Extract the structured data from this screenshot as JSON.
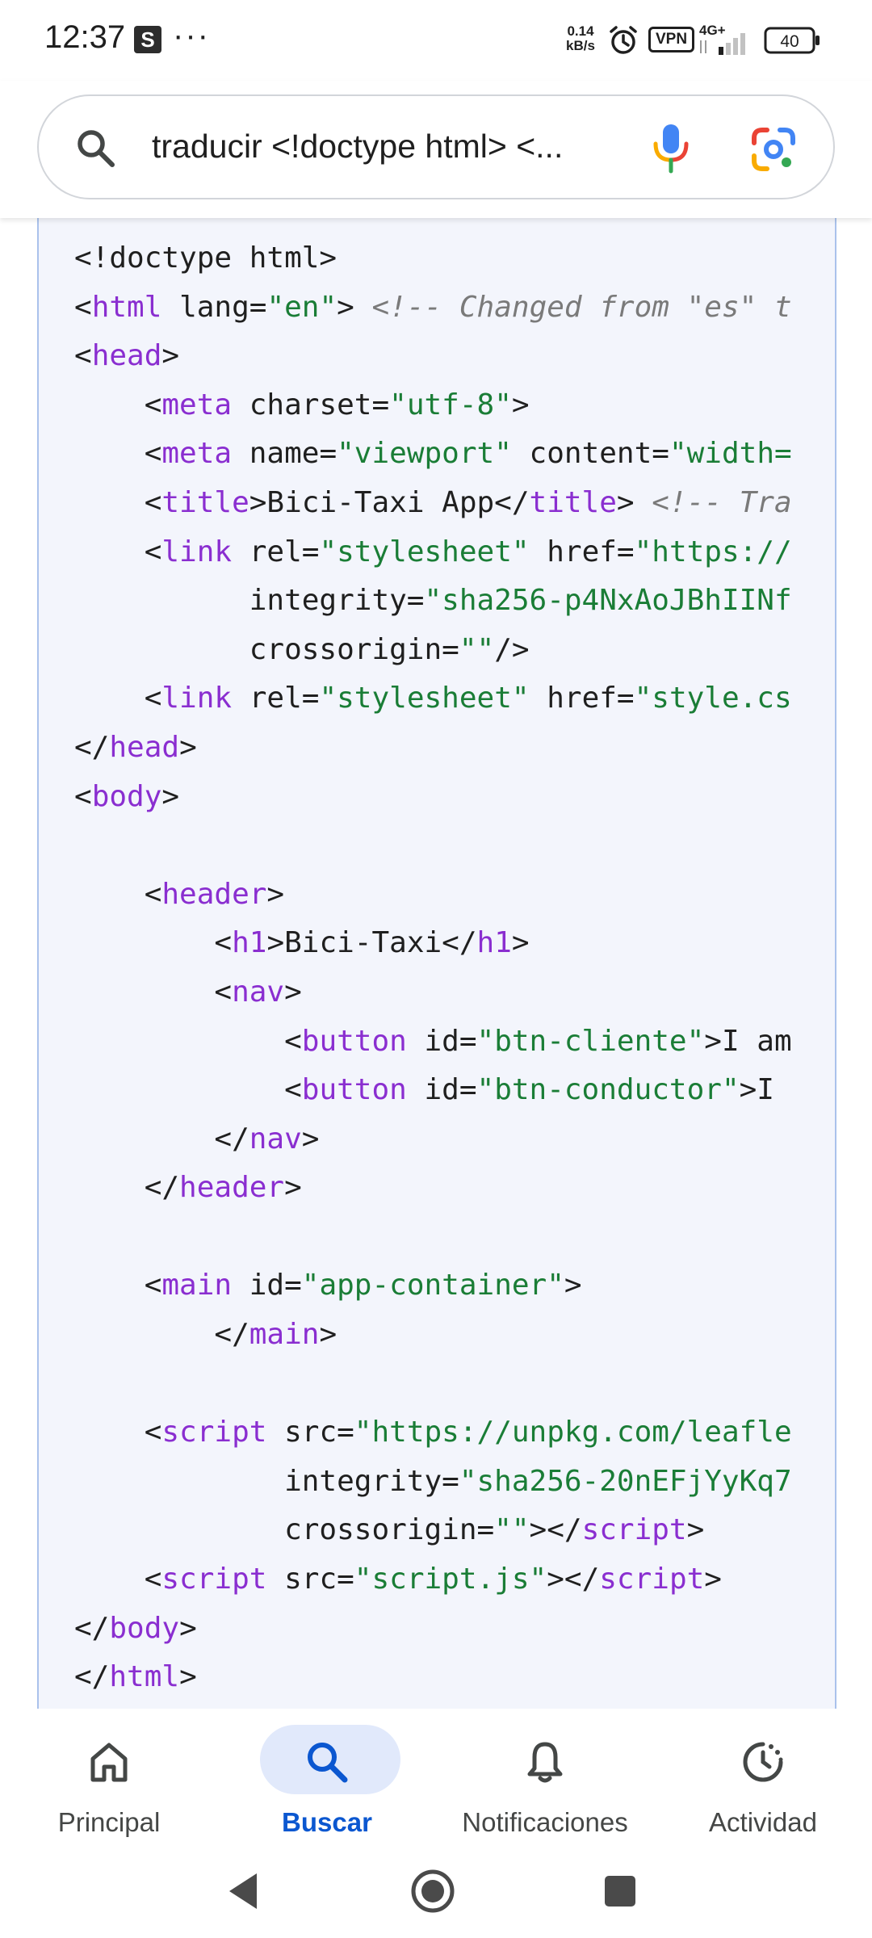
{
  "status_bar": {
    "time": "12:37",
    "app_badge": "S",
    "more": "···",
    "speed_value": "0.14",
    "speed_unit": "kB/s",
    "vpn": "VPN",
    "network": "4G+",
    "battery": "40"
  },
  "search": {
    "query": "traducir <!doctype html> <..."
  },
  "code": {
    "lines": [
      [
        [
          "pun",
          "<!doctype html>"
        ]
      ],
      [
        [
          "pun",
          "<"
        ],
        [
          "tag",
          "html"
        ],
        [
          "pun",
          " lang="
        ],
        [
          "str",
          "\"en\""
        ],
        [
          "pun",
          "> "
        ],
        [
          "com",
          "<!-- Changed from \"es\" t"
        ]
      ],
      [
        [
          "pun",
          "<"
        ],
        [
          "tag",
          "head"
        ],
        [
          "pun",
          ">"
        ]
      ],
      [
        [
          "pun",
          "    <"
        ],
        [
          "tag",
          "meta"
        ],
        [
          "pun",
          " charset="
        ],
        [
          "str",
          "\"utf-8\""
        ],
        [
          "pun",
          ">"
        ]
      ],
      [
        [
          "pun",
          "    <"
        ],
        [
          "tag",
          "meta"
        ],
        [
          "pun",
          " name="
        ],
        [
          "str",
          "\"viewport\""
        ],
        [
          "pun",
          " content="
        ],
        [
          "str",
          "\"width="
        ]
      ],
      [
        [
          "pun",
          "    <"
        ],
        [
          "tag",
          "title"
        ],
        [
          "pun",
          ">Bici-Taxi App</"
        ],
        [
          "tag",
          "title"
        ],
        [
          "pun",
          "> "
        ],
        [
          "com",
          "<!-- Tra"
        ]
      ],
      [
        [
          "pun",
          "    <"
        ],
        [
          "tag",
          "link"
        ],
        [
          "pun",
          " rel="
        ],
        [
          "str",
          "\"stylesheet\""
        ],
        [
          "pun",
          " href="
        ],
        [
          "str",
          "\"https://"
        ]
      ],
      [
        [
          "pun",
          "          integrity="
        ],
        [
          "str",
          "\"sha256-p4NxAoJBhIINf"
        ]
      ],
      [
        [
          "pun",
          "          crossorigin="
        ],
        [
          "str",
          "\"\""
        ],
        [
          "pun",
          "/>"
        ]
      ],
      [
        [
          "pun",
          "    <"
        ],
        [
          "tag",
          "link"
        ],
        [
          "pun",
          " rel="
        ],
        [
          "str",
          "\"stylesheet\""
        ],
        [
          "pun",
          " href="
        ],
        [
          "str",
          "\"style.cs"
        ]
      ],
      [
        [
          "pun",
          "</"
        ],
        [
          "tag",
          "head"
        ],
        [
          "pun",
          ">"
        ]
      ],
      [
        [
          "pun",
          "<"
        ],
        [
          "tag",
          "body"
        ],
        [
          "pun",
          ">"
        ]
      ],
      [],
      [
        [
          "pun",
          "    <"
        ],
        [
          "tag",
          "header"
        ],
        [
          "pun",
          ">"
        ]
      ],
      [
        [
          "pun",
          "        <"
        ],
        [
          "tag",
          "h1"
        ],
        [
          "pun",
          ">Bici-Taxi</"
        ],
        [
          "tag",
          "h1"
        ],
        [
          "pun",
          ">"
        ]
      ],
      [
        [
          "pun",
          "        <"
        ],
        [
          "tag",
          "nav"
        ],
        [
          "pun",
          ">"
        ]
      ],
      [
        [
          "pun",
          "            <"
        ],
        [
          "tag",
          "button"
        ],
        [
          "pun",
          " id="
        ],
        [
          "str",
          "\"btn-cliente\""
        ],
        [
          "pun",
          ">I am"
        ]
      ],
      [
        [
          "pun",
          "            <"
        ],
        [
          "tag",
          "button"
        ],
        [
          "pun",
          " id="
        ],
        [
          "str",
          "\"btn-conductor\""
        ],
        [
          "pun",
          ">I"
        ]
      ],
      [
        [
          "pun",
          "        </"
        ],
        [
          "tag",
          "nav"
        ],
        [
          "pun",
          ">"
        ]
      ],
      [
        [
          "pun",
          "    </"
        ],
        [
          "tag",
          "header"
        ],
        [
          "pun",
          ">"
        ]
      ],
      [],
      [
        [
          "pun",
          "    <"
        ],
        [
          "tag",
          "main"
        ],
        [
          "pun",
          " id="
        ],
        [
          "str",
          "\"app-container\""
        ],
        [
          "pun",
          ">"
        ]
      ],
      [
        [
          "pun",
          "        </"
        ],
        [
          "tag",
          "main"
        ],
        [
          "pun",
          ">"
        ]
      ],
      [],
      [
        [
          "pun",
          "    <"
        ],
        [
          "tag",
          "script"
        ],
        [
          "pun",
          " src="
        ],
        [
          "str",
          "\"https://unpkg.com/leafle"
        ]
      ],
      [
        [
          "pun",
          "            integrity="
        ],
        [
          "str",
          "\"sha256-20nEFjYyKq7"
        ]
      ],
      [
        [
          "pun",
          "            crossorigin="
        ],
        [
          "str",
          "\"\""
        ],
        [
          "pun",
          "></"
        ],
        [
          "tag",
          "script"
        ],
        [
          "pun",
          ">"
        ]
      ],
      [
        [
          "pun",
          "    <"
        ],
        [
          "tag",
          "script"
        ],
        [
          "pun",
          " src="
        ],
        [
          "str",
          "\"script.js\""
        ],
        [
          "pun",
          "></"
        ],
        [
          "tag",
          "script"
        ],
        [
          "pun",
          ">"
        ]
      ],
      [
        [
          "pun",
          "</"
        ],
        [
          "tag",
          "body"
        ],
        [
          "pun",
          ">"
        ]
      ],
      [
        [
          "pun",
          "</"
        ],
        [
          "tag",
          "html"
        ],
        [
          "pun",
          ">"
        ]
      ]
    ]
  },
  "bottom_nav": {
    "items": [
      {
        "label": "Principal",
        "icon": "home-icon",
        "active": false
      },
      {
        "label": "Buscar",
        "icon": "search-icon",
        "active": true
      },
      {
        "label": "Notificaciones",
        "icon": "bell-icon",
        "active": false
      },
      {
        "label": "Actividad",
        "icon": "activity-icon",
        "active": false
      }
    ]
  },
  "colors": {
    "accent": "#0b57d0",
    "tag": "#8a2ed0",
    "string": "#1a7d36",
    "comment": "#7a7a7a",
    "code_background": "#f3f5fc"
  }
}
